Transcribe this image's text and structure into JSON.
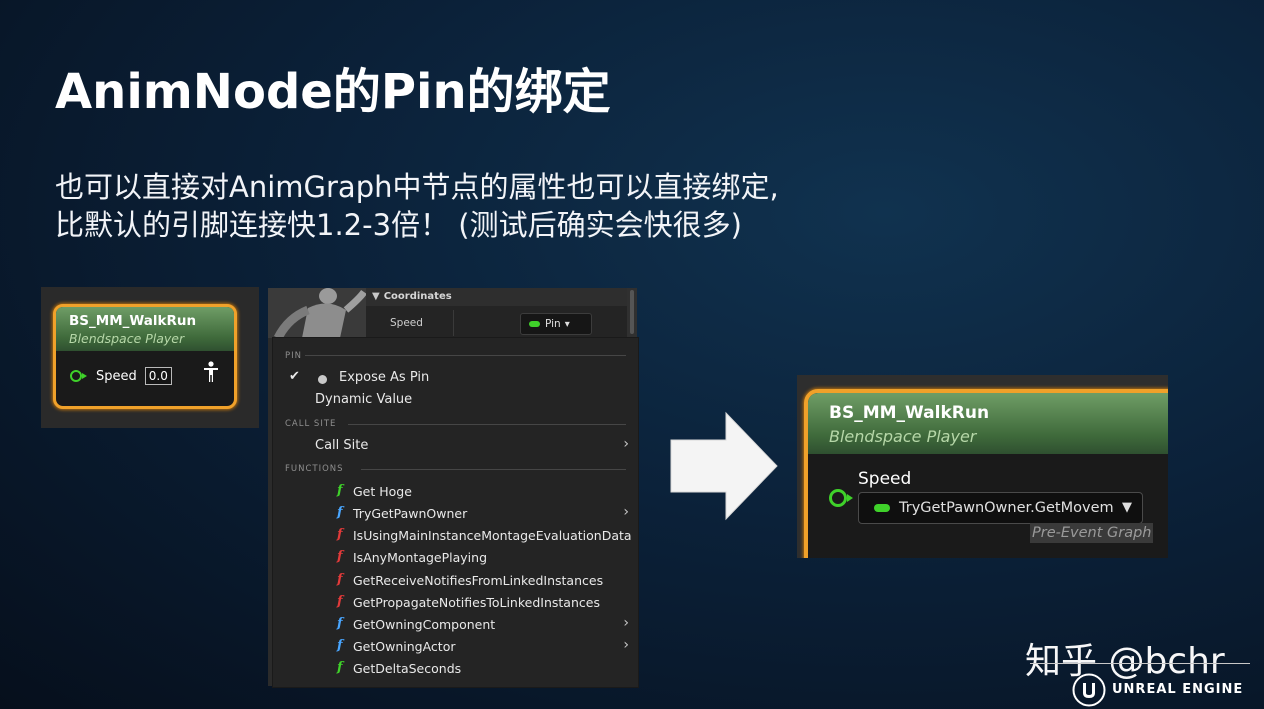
{
  "slide": {
    "title": "AnimNode的Pin的绑定",
    "subtitle_lines": [
      "也可以直接对AnimGraph中节点的属性也可以直接绑定,",
      "比默认的引脚连接快1.2-3倍！ (测试后确实会快很多)"
    ]
  },
  "left_node": {
    "title": "BS_MM_WalkRun",
    "subtitle": "Blendspace Player",
    "pin_label": "Speed",
    "pin_value": "0.0",
    "pin_icon": "green-pin-circle",
    "output_icon": "person-icon"
  },
  "details": {
    "section": "Coordinates",
    "property_name": "Speed",
    "pin_combo_label": "Pin"
  },
  "context_menu": {
    "pin_section": "PIN",
    "expose_as_pin": "Expose As Pin",
    "dynamic_value": "Dynamic Value",
    "call_site_section": "CALL SITE",
    "call_site": "Call Site",
    "functions_section": "FUNCTIONS",
    "functions": [
      {
        "label": "Get Hoge",
        "color": "green",
        "submenu": false
      },
      {
        "label": "TryGetPawnOwner",
        "color": "blue",
        "submenu": true
      },
      {
        "label": "IsUsingMainInstanceMontageEvaluationData",
        "color": "red",
        "submenu": false
      },
      {
        "label": "IsAnyMontagePlaying",
        "color": "red",
        "submenu": false
      },
      {
        "label": "GetReceiveNotifiesFromLinkedInstances",
        "color": "red",
        "submenu": false
      },
      {
        "label": "GetPropagateNotifiesToLinkedInstances",
        "color": "red",
        "submenu": false
      },
      {
        "label": "GetOwningComponent",
        "color": "blue",
        "submenu": true
      },
      {
        "label": "GetOwningActor",
        "color": "blue",
        "submenu": true
      },
      {
        "label": "GetDeltaSeconds",
        "color": "green",
        "submenu": false
      }
    ]
  },
  "right_node": {
    "title": "BS_MM_WalkRun",
    "subtitle": "Blendspace Player",
    "pin_label": "Speed",
    "binding_value": "TryGetPawnOwner.GetMovem",
    "binding_tooltip": "Pre-Event Graph"
  },
  "watermark": {
    "text": "知乎 @bchr",
    "engine_logo_text": "UNREAL ENGINE"
  },
  "colors": {
    "node_border": "#f0a12a",
    "pin_green": "#3fd12a",
    "function_blue": "#49a6ff",
    "function_red": "#e23a3a"
  }
}
